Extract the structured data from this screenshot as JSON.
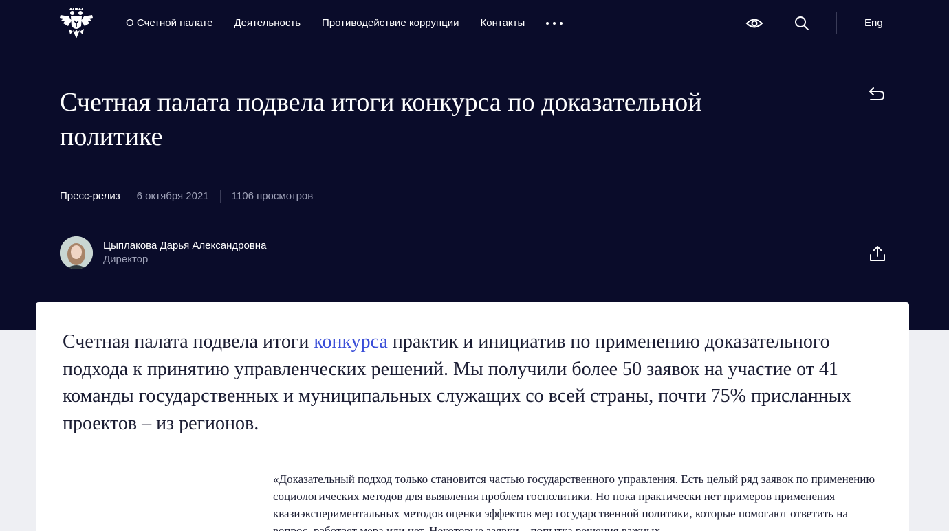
{
  "header": {
    "logo_icon": "double-headed-eagle-emblem",
    "nav": [
      "О Счетной палате",
      "Деятельность",
      "Противодействие коррупции",
      "Контакты"
    ],
    "more_icon": "more-dots-icon",
    "accessibility_icon": "eye-icon",
    "search_icon": "search-icon",
    "lang": "Eng"
  },
  "article": {
    "title_line1": "Счетная палата подвела итоги конкурса по доказательной",
    "title_line2": "политике",
    "type": "Пресс-релиз",
    "date": "6 октября 2021",
    "views": "1106 просмотров",
    "back_icon": "back-arrow-icon",
    "share_icon": "share-icon"
  },
  "author": {
    "name": "Цыплакова Дарья Александровна",
    "role": "Директор"
  },
  "body": {
    "lead_before": "Счетная палата подвела итоги ",
    "lead_link": "конкурса",
    "lead_after": " практик и инициатив по применению доказательного подхода к принятию управленческих решений. Мы получили более 50 заявок на участие от 41 команды государственных и муниципальных служащих со всей страны, почти 75% присланных проектов – из регионов.",
    "quote": "«Доказательный подход только становится частью государственного управления. Есть целый ряд заявок по применению социологических методов для выявления проблем госполитики. Но пока практически нет примеров применения квазиэкспериментальных методов оценки эффектов мер государственной политики, которые помогают ответить на вопрос, работает мера или нет. Некоторые заявки – попытка решения важных"
  },
  "colors": {
    "hero_bg": "#0a0c2a",
    "link": "#3b4fd8",
    "muted": "#9fa2b8",
    "page_bg": "#eeeff3"
  }
}
